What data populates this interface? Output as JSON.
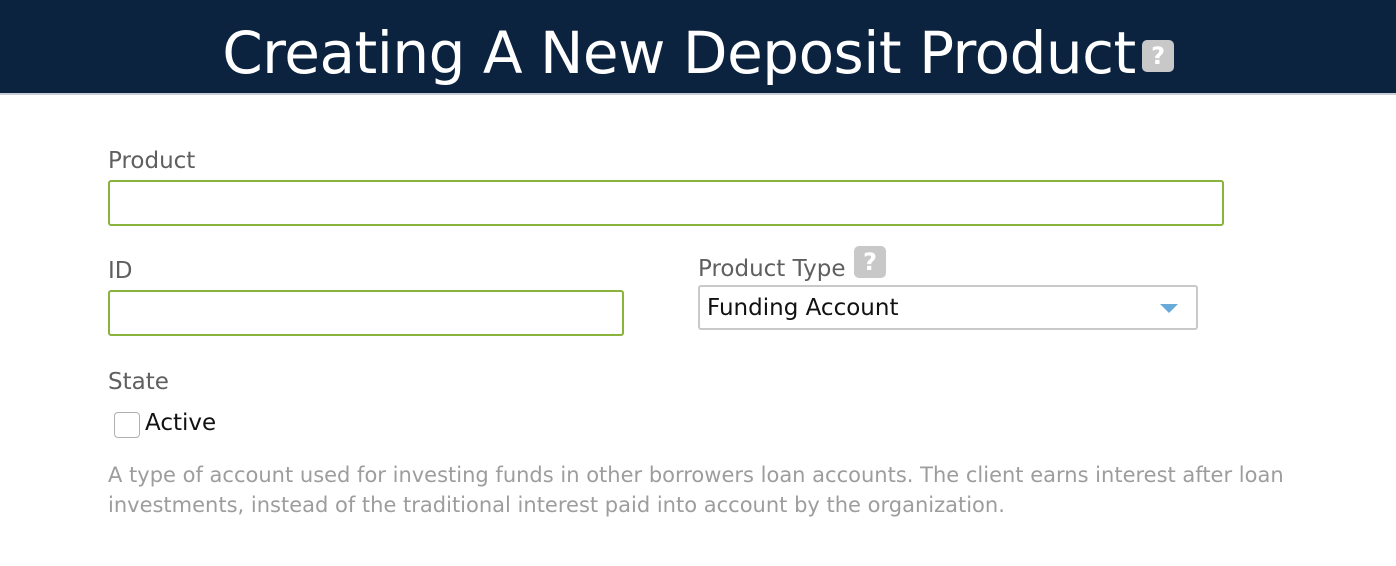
{
  "header": {
    "title": "Creating A New Deposit Product",
    "help_icon": "help-icon",
    "help_glyph": "?"
  },
  "form": {
    "product": {
      "label": "Product",
      "value": ""
    },
    "id": {
      "label": "ID",
      "value": ""
    },
    "product_type": {
      "label": "Product Type",
      "help_glyph": "?",
      "selected": "Funding Account",
      "caret_icon": "chevron-down-icon"
    },
    "state": {
      "label": "State",
      "checkbox_label": "Active",
      "checked": false
    },
    "description": "A type of account used for investing funds in other borrowers loan accounts. The client earns interest after loan investments, instead of the traditional interest paid into account by the organization."
  },
  "colors": {
    "header_bg": "#0c2340",
    "input_border_focus": "#8ab33c",
    "select_border": "#c9c9c9",
    "caret": "#6aaad9",
    "label_text": "#5f5f5f",
    "description_text": "#9d9d9d"
  }
}
